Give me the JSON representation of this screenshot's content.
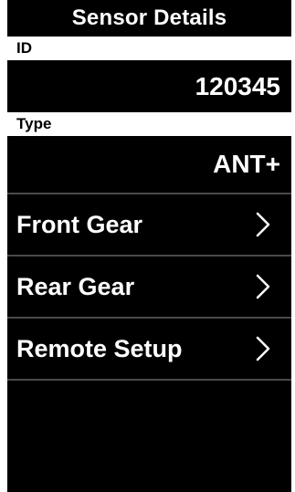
{
  "header": {
    "title": "Sensor Details"
  },
  "id_section": {
    "label": "ID",
    "value": "120345"
  },
  "type_section": {
    "label": "Type",
    "value": "ANT+"
  },
  "menu": [
    {
      "label": "Front Gear",
      "icon": "chevron-right-icon"
    },
    {
      "label": "Rear Gear",
      "icon": "chevron-right-icon"
    },
    {
      "label": "Remote Setup",
      "icon": "chevron-right-icon"
    }
  ],
  "colors": {
    "background": "#000000",
    "text": "#ffffff",
    "label_bar": "#ffffff",
    "divider": "#4a4a4a"
  }
}
